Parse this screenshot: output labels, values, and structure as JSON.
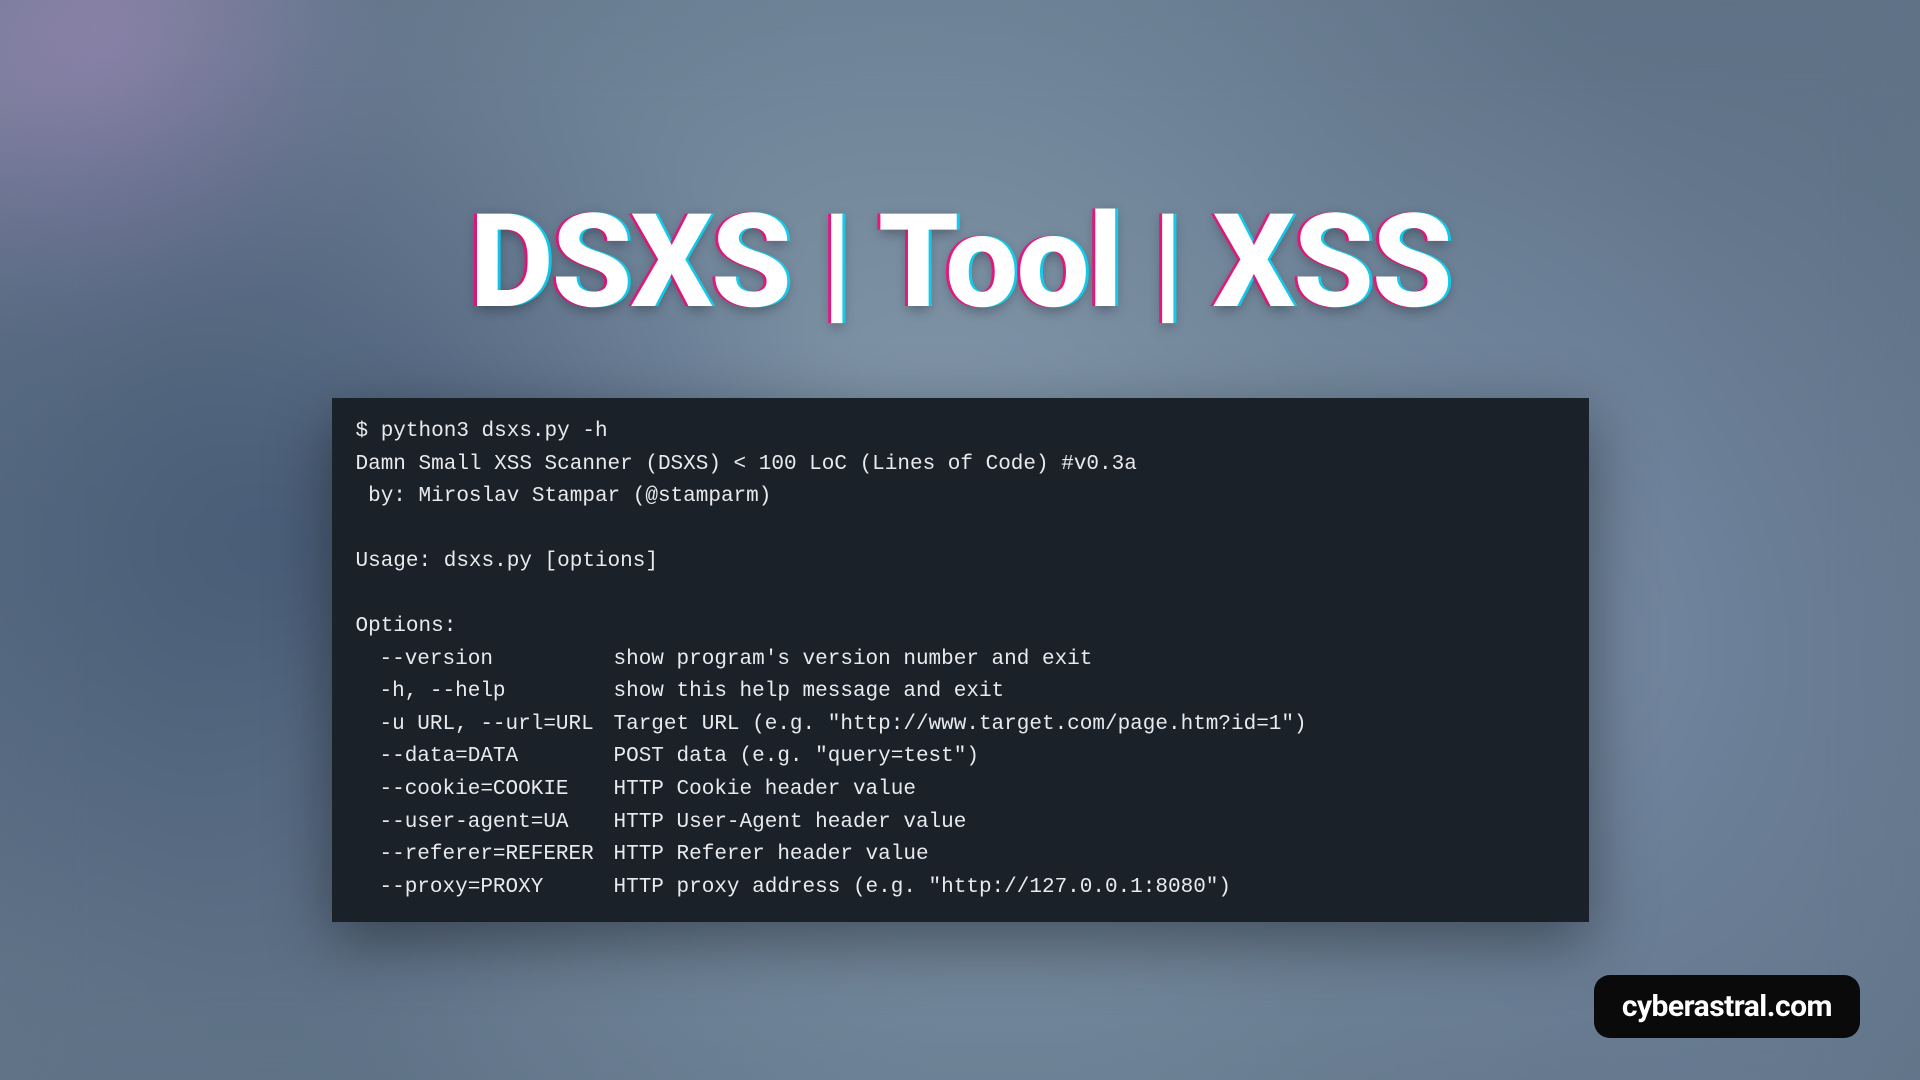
{
  "title": "DSXS | Tool | XSS",
  "terminal": {
    "prompt": "$ python3 dsxs.py -h",
    "banner1": "Damn Small XSS Scanner (DSXS) < 100 LoC (Lines of Code) #v0.3a",
    "banner2": " by: Miroslav Stampar (@stamparm)",
    "usage": "Usage: dsxs.py [options]",
    "options_header": "Options:",
    "options": [
      {
        "flag": "--version",
        "desc": "show program's version number and exit"
      },
      {
        "flag": "-h, --help",
        "desc": "show this help message and exit"
      },
      {
        "flag": "-u URL, --url=URL",
        "desc": "Target URL (e.g. \"http://www.target.com/page.htm?id=1\")"
      },
      {
        "flag": "--data=DATA",
        "desc": "POST data (e.g. \"query=test\")"
      },
      {
        "flag": "--cookie=COOKIE",
        "desc": "HTTP Cookie header value"
      },
      {
        "flag": "--user-agent=UA",
        "desc": "HTTP User-Agent header value"
      },
      {
        "flag": "--referer=REFERER",
        "desc": "HTTP Referer header value"
      },
      {
        "flag": "--proxy=PROXY",
        "desc": "HTTP proxy address (e.g. \"http://127.0.0.1:8080\")"
      }
    ]
  },
  "watermark": "cyberastral.com"
}
